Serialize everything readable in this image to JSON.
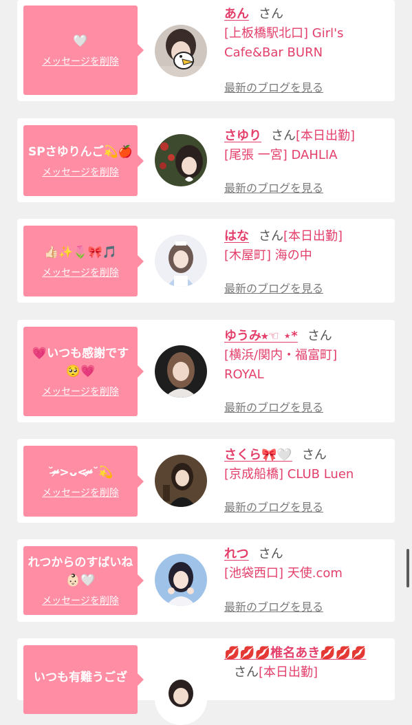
{
  "cards": [
    {
      "message": "🤍",
      "delete_label": "メッセージを削除",
      "name": "あん",
      "san": "さん",
      "attend": "",
      "shop": "[上板橋駅北口] Girl's Cafe&Bar BURN",
      "blog_label": "最新のブログを見る"
    },
    {
      "message": "SPさゆりんご💫🍎",
      "delete_label": "メッセージを削除",
      "name": "さゆり",
      "san": "さん",
      "attend": "[本日出勤]",
      "shop": "[尾張 一宮] DAHLIA",
      "blog_label": "最新のブログを見る"
    },
    {
      "message": "👍🏻✨🌷🎀🎵",
      "delete_label": "メッセージを削除",
      "name": "はな",
      "san": "さん",
      "attend": "[本日出勤]",
      "shop": "[木屋町] 海の中",
      "blog_label": "最新のブログを見る"
    },
    {
      "message": "💗いつも感謝です🥺💗",
      "delete_label": "メッセージを削除",
      "name": "ゆうみ⭒☜ ⋆*",
      "san": "さん",
      "attend": "",
      "shop": "[横浜/関内・福富町] ROYAL",
      "blog_label": "最新のブログを見る"
    },
    {
      "message": "˘ᵕ̴̶̷>ᴗ<ᵕ̴̶̷˘💫",
      "delete_label": "メッセージを削除",
      "name": "さくら🎀🤍",
      "san": "さん",
      "attend": "",
      "shop": "[京成船橋] CLUB Luen",
      "blog_label": "最新のブログを見る"
    },
    {
      "message": "れつからのすばいね👶🏻🤍",
      "delete_label": "メッセージを削除",
      "name": "れつ",
      "san": "さん",
      "attend": "",
      "shop": "[池袋西口] 天使.com",
      "blog_label": "最新のブログを見る"
    },
    {
      "message": "いつも有難うござ",
      "delete_label": "",
      "name": "💋💋💋椎名あき💋💋💋",
      "san": "さん",
      "attend": "[本日出勤]",
      "shop": "",
      "blog_label": ""
    }
  ],
  "colors": {
    "accent": "#e33f6a",
    "bubble": "#ff8ea5",
    "background": "#f1f0f0"
  }
}
